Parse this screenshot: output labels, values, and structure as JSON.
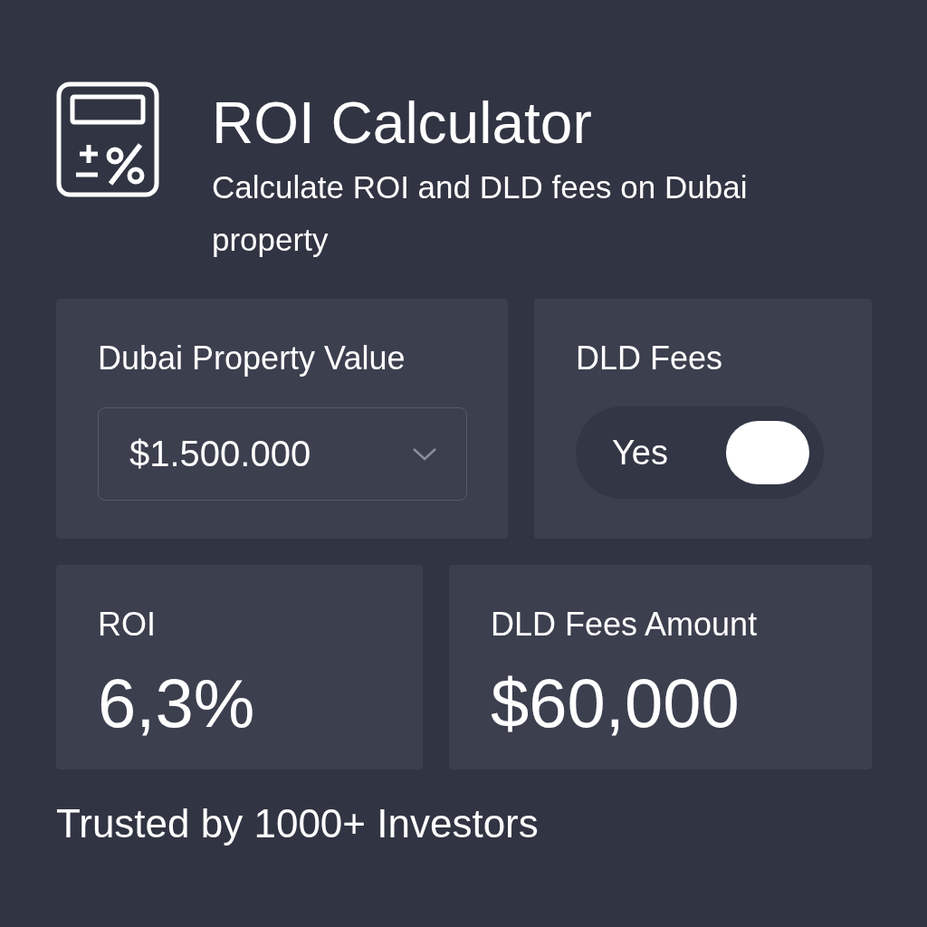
{
  "header": {
    "title": "ROI Calculator",
    "subtitle": "Calculate ROI and DLD fees on Dubai property"
  },
  "inputs": [
    {
      "kind": "select",
      "label": "Dubai Property Value",
      "value": "$1.500.000"
    },
    {
      "kind": "toggle",
      "label": "DLD Fees",
      "on": true,
      "value_label": "Yes"
    }
  ],
  "results": [
    {
      "label": "ROI",
      "value": "6,3%"
    },
    {
      "label": "DLD Fees Amount",
      "value": "$60,000"
    }
  ],
  "footer": {
    "text": "Trusted by 1000+ Investors"
  }
}
